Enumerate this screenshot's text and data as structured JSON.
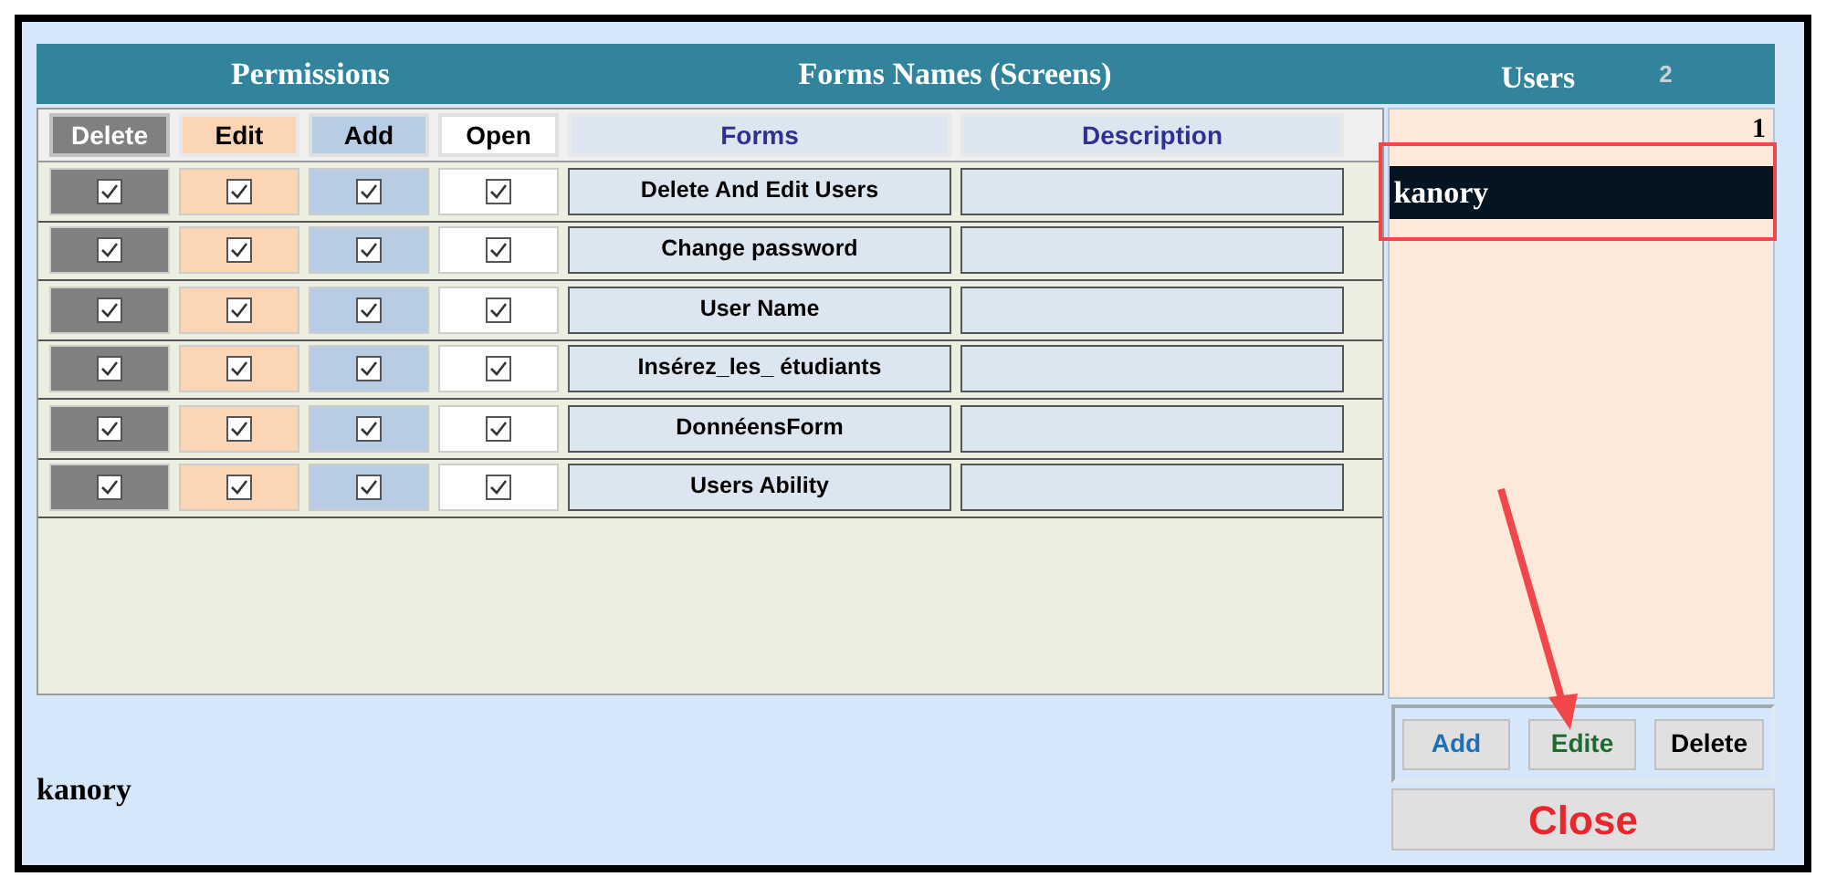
{
  "header": {
    "permissions": "Permissions",
    "forms_names": "Forms Names (Screens)",
    "users": "Users",
    "users_count": "2"
  },
  "columns": [
    {
      "label": "Delete",
      "kind": "delete"
    },
    {
      "label": "Edit",
      "kind": "edit"
    },
    {
      "label": "Add",
      "kind": "add"
    },
    {
      "label": "Open",
      "kind": "open"
    },
    {
      "label": "Forms",
      "kind": "form"
    },
    {
      "label": "Description",
      "kind": "description"
    }
  ],
  "rows": [
    {
      "form": "Delete And Edit Users",
      "delete": true,
      "edit": true,
      "add": true,
      "open": true
    },
    {
      "form": "Change password",
      "delete": true,
      "edit": true,
      "add": true,
      "open": true
    },
    {
      "form": "User Name",
      "delete": true,
      "edit": true,
      "add": true,
      "open": true
    },
    {
      "form": "Insérez_les_ étudiants",
      "delete": true,
      "edit": true,
      "add": true,
      "open": true
    },
    {
      "form": "DonnéensForm",
      "delete": true,
      "edit": true,
      "add": true,
      "open": true
    },
    {
      "form": "Users Ability",
      "delete": true,
      "edit": true,
      "add": true,
      "open": true
    }
  ],
  "users_panel": {
    "index": "1",
    "users": [
      {
        "name": "kanory",
        "selected": true
      }
    ]
  },
  "current_user": "kanory",
  "buttons": [
    {
      "label": "Add",
      "kind": "add"
    },
    {
      "label": "Edite",
      "kind": "edit"
    },
    {
      "label": "Delete",
      "kind": "delete"
    }
  ],
  "close_button": "Close"
}
